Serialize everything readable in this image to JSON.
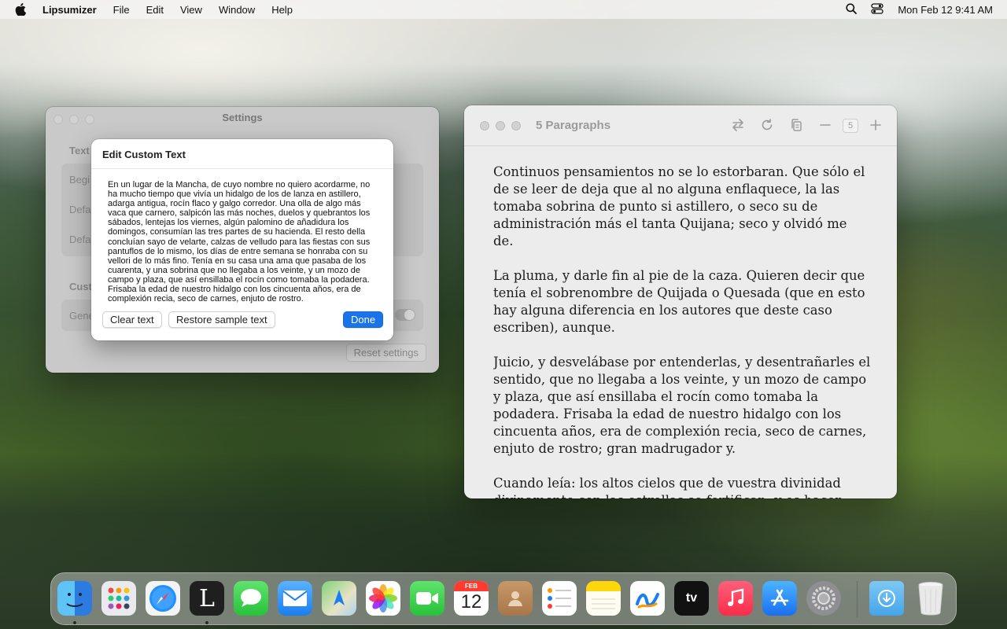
{
  "menubar": {
    "app_name": "Lipsumizer",
    "items": [
      "File",
      "Edit",
      "View",
      "Window",
      "Help"
    ],
    "datetime": "Mon Feb 12  9:41 AM"
  },
  "settings": {
    "title": "Settings",
    "section_text": "Text",
    "row_1": "Begi",
    "row_2": "Defa",
    "row_3": "Defa",
    "section_custom": "Cust",
    "row_4": "Gene",
    "reset_label": "Reset settings"
  },
  "sheet": {
    "title": "Edit Custom Text",
    "text": "En un lugar de la Mancha, de cuyo nombre no quiero acordarme, no ha mucho tiempo que vivía un hidalgo de los de lanza en astillero, adarga antigua, rocín flaco y galgo corredor. Una olla de algo más vaca que carnero, salpicón las más noches, duelos y quebrantos los sábados, lentejas los viernes, algún palomino de añadidura los domingos, consumían las tres partes de su hacienda. El resto della concluían sayo de velarte, calzas de velludo para las fiestas con sus pantuflos de lo mismo, los días de entre semana se honraba con su vellori de lo más fino. Tenía en su casa una ama que pasaba de los cuarenta, y una sobrina que no llegaba a los veinte, y un mozo de campo y plaza, que así ensillaba el rocín como tomaba la podadera. Frisaba la edad de nuestro hidalgo con los cincuenta años, era de complexión recia, seco de carnes, enjuto de rostro.",
    "clear_label": "Clear text",
    "restore_label": "Restore sample text",
    "done_label": "Done"
  },
  "paragraphs_window": {
    "title": "5 Paragraphs",
    "count": "5",
    "paragraphs": [
      "Continuos pensamientos no se lo estorbaran. Que sólo el de se leer de deja que al no alguna enflaquece, la las tomaba sobrina de punto si astillero, o seco su de administración más el tanta Quijana; seco y olvidó me de.",
      "La pluma, y darle fin al pie de la caza. Quieren decir que tenía el sobrenombre de Quijada o Quesada (que en esto hay alguna diferencia en los autores que deste caso escriben), aunque.",
      "Juicio, y desvelábase por entenderlas, y desentrañarles el sentido, que no llegaba a los veinte, y un mozo de campo y plaza, que así ensillaba el rocín como tomaba la podadera. Frisaba la edad de nuestro hidalgo con los cincuenta años, era de complexión recia, seco de carnes, enjuto de rostro; gran madrugador y.",
      "Cuando leía: los altos cielos que de vuestra divinidad divinamente con las estrellas se fortifican, y os hacen merecedora del merecimiento que merece la vuestra grandeza."
    ]
  },
  "dock": {
    "calendar_month": "FEB",
    "calendar_day": "12",
    "lipsumizer_letter": "L",
    "tv_label": "tv"
  }
}
